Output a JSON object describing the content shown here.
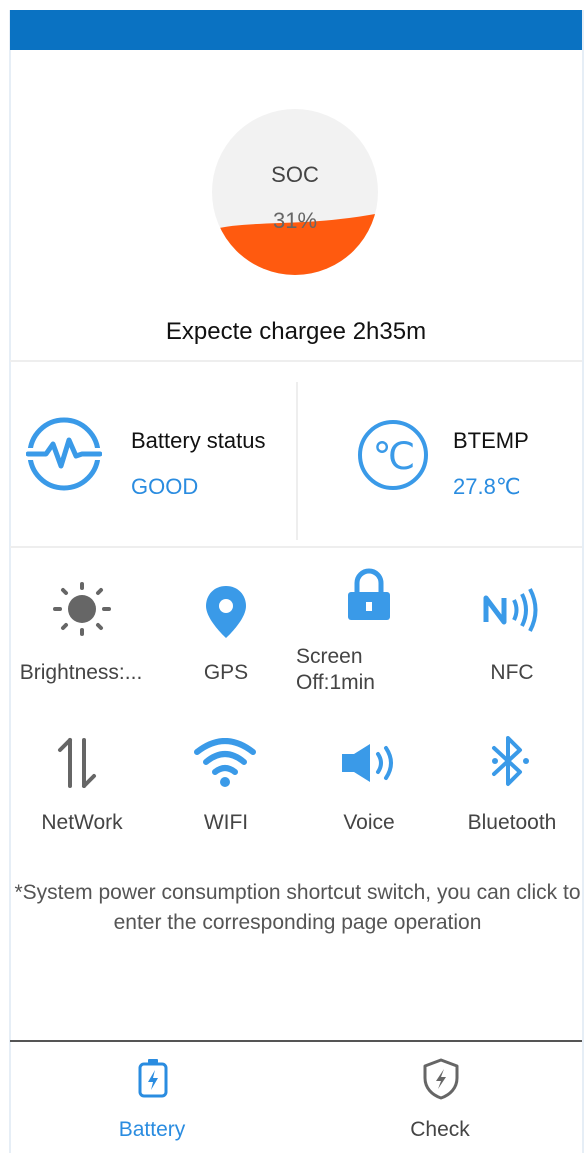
{
  "soc": {
    "label": "SOC",
    "value": "31%",
    "fill_fraction": 0.31
  },
  "charge": {
    "expected_text": "Expecte chargee 2h35m"
  },
  "status": {
    "battery": {
      "title": "Battery status",
      "value": "GOOD"
    },
    "temp": {
      "title": "BTEMP",
      "value": "27.8℃"
    }
  },
  "shortcuts": [
    {
      "label": "Brightness:...",
      "icon": "brightness-icon"
    },
    {
      "label": "GPS",
      "icon": "location-pin-icon"
    },
    {
      "label": "Screen Off:1min",
      "icon": "lock-icon"
    },
    {
      "label": "NFC",
      "icon": "nfc-icon"
    },
    {
      "label": "NetWork",
      "icon": "network-arrows-icon"
    },
    {
      "label": "WIFI",
      "icon": "wifi-icon"
    },
    {
      "label": "Voice",
      "icon": "speaker-icon"
    },
    {
      "label": "Bluetooth",
      "icon": "bluetooth-icon"
    }
  ],
  "note": "*System power consumption shortcut switch, you can click to enter the corresponding page operation",
  "nav": [
    {
      "label": "Battery",
      "icon": "battery-charging-icon",
      "active": true
    },
    {
      "label": "Check",
      "icon": "shield-lightning-icon",
      "active": false
    }
  ],
  "colors": {
    "header": "#0a72c2",
    "accent": "#2a8ce0",
    "soc_fill": "#ff5a0f",
    "soc_bg": "#f2f2f2",
    "icon_gray": "#666666",
    "icon_blue": "#3a9ae8"
  }
}
